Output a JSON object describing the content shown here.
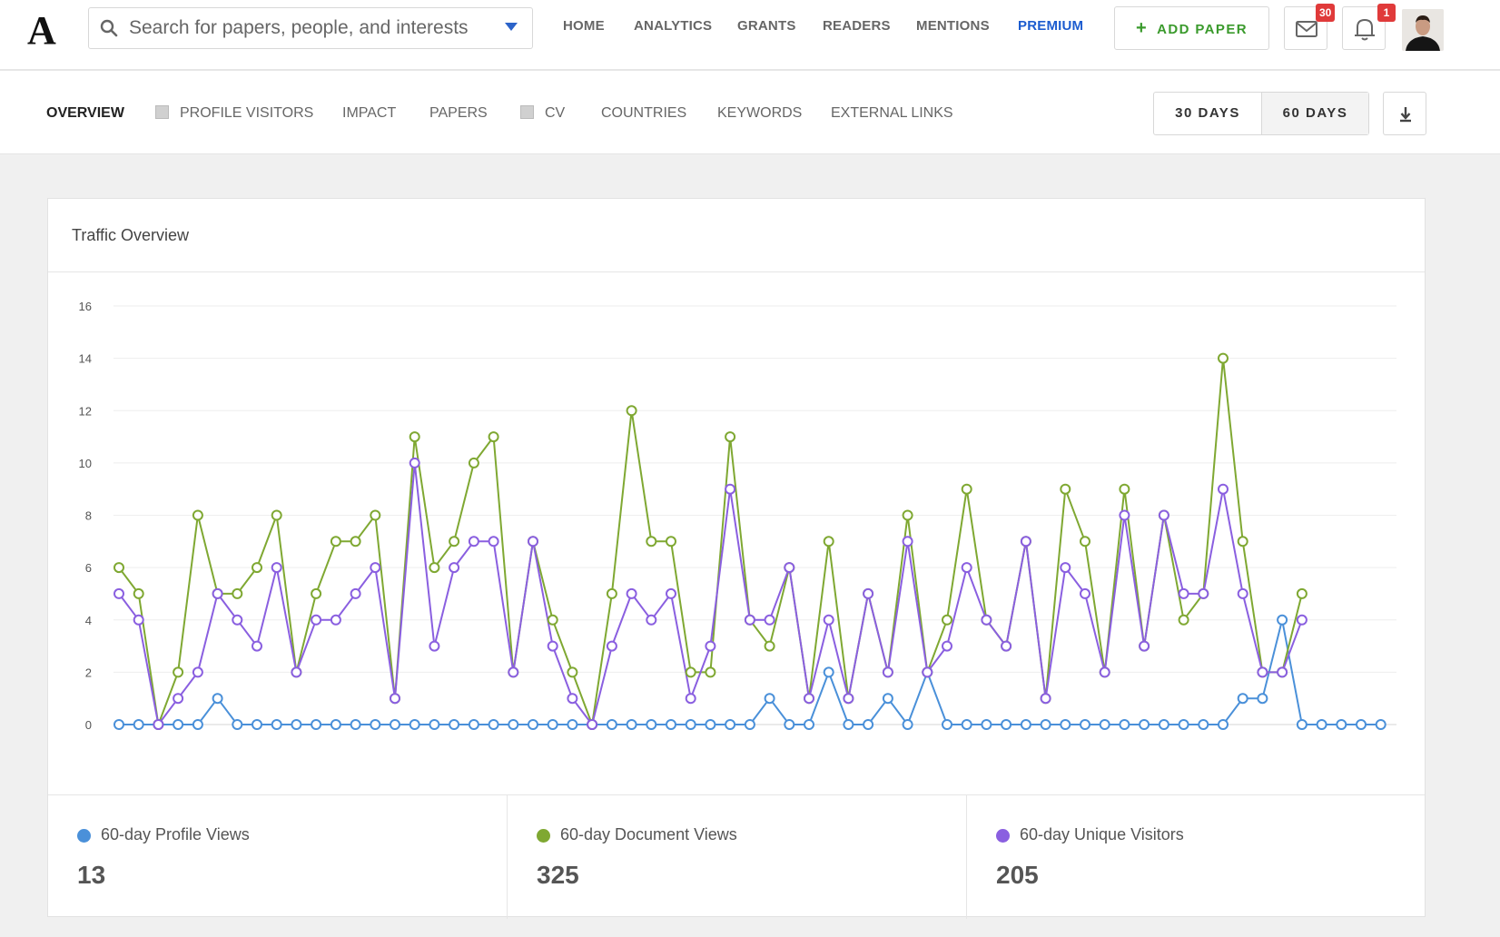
{
  "header": {
    "logo_text": "A",
    "search": {
      "placeholder": "Search for papers, people, and interests"
    },
    "nav": [
      {
        "label": "HOME"
      },
      {
        "label": "ANALYTICS"
      },
      {
        "label": "GRANTS"
      },
      {
        "label": "READERS"
      },
      {
        "label": "MENTIONS"
      },
      {
        "label": "PREMIUM"
      }
    ],
    "add_paper_label": "ADD PAPER",
    "messages_badge": "30",
    "notifications_badge": "1"
  },
  "subnav": {
    "tabs": [
      {
        "label": "OVERVIEW"
      },
      {
        "label": "PROFILE VISITORS"
      },
      {
        "label": "IMPACT"
      },
      {
        "label": "PAPERS"
      },
      {
        "label": "CV"
      },
      {
        "label": "COUNTRIES"
      },
      {
        "label": "KEYWORDS"
      },
      {
        "label": "EXTERNAL LINKS"
      }
    ],
    "range": {
      "option_30": "30 DAYS",
      "option_60": "60 DAYS",
      "selected": "60 DAYS"
    }
  },
  "card": {
    "title": "Traffic Overview"
  },
  "colors": {
    "profile": "#4a90d9",
    "document": "#7fa832",
    "visitors": "#8a5fe0",
    "accent": "#1c5ccf",
    "add": "#3a9a2c"
  },
  "chart_data": {
    "type": "line",
    "title": "Traffic Overview",
    "ylim": [
      0,
      16
    ],
    "yticks": [
      0,
      2,
      4,
      6,
      8,
      10,
      12,
      14,
      16
    ],
    "grid": true,
    "series": [
      {
        "name": "60-day Profile Views",
        "color": "#4a90d9",
        "values": [
          0,
          0,
          0,
          0,
          0,
          1,
          0,
          0,
          0,
          0,
          0,
          0,
          0,
          0,
          0,
          0,
          0,
          0,
          0,
          0,
          0,
          0,
          0,
          0,
          0,
          0,
          0,
          0,
          0,
          0,
          0,
          0,
          0,
          1,
          0,
          0,
          2,
          0,
          0,
          1,
          0,
          2,
          0,
          0,
          0,
          0,
          0,
          0,
          0,
          0,
          0,
          0,
          0,
          0,
          0,
          0,
          0,
          1,
          1,
          4,
          0,
          0,
          0,
          0,
          0
        ]
      },
      {
        "name": "60-day Document Views",
        "color": "#7fa832",
        "values": [
          6,
          5,
          0,
          2,
          8,
          5,
          5,
          6,
          8,
          2,
          5,
          7,
          7,
          8,
          1,
          11,
          6,
          7,
          10,
          11,
          2,
          7,
          4,
          2,
          0,
          5,
          12,
          7,
          7,
          2,
          2,
          11,
          4,
          3,
          6,
          1,
          7,
          1,
          5,
          2,
          8,
          2,
          4,
          9,
          4,
          3,
          7,
          1,
          9,
          7,
          2,
          9,
          3,
          8,
          4,
          5,
          14,
          7,
          2,
          2,
          5
        ]
      },
      {
        "name": "60-day Unique Visitors",
        "color": "#8a5fe0",
        "values": [
          5,
          4,
          0,
          1,
          2,
          5,
          4,
          3,
          6,
          2,
          4,
          4,
          5,
          6,
          1,
          10,
          3,
          6,
          7,
          7,
          2,
          7,
          3,
          1,
          0,
          3,
          5,
          4,
          5,
          1,
          3,
          9,
          4,
          4,
          6,
          1,
          4,
          1,
          5,
          2,
          7,
          2,
          3,
          6,
          4,
          3,
          7,
          1,
          6,
          5,
          2,
          8,
          3,
          8,
          5,
          5,
          9,
          5,
          2,
          2,
          4
        ]
      }
    ]
  },
  "stats": [
    {
      "label": "60-day Profile Views",
      "value": "13",
      "color": "#4a90d9"
    },
    {
      "label": "60-day Document Views",
      "value": "325",
      "color": "#7fa832"
    },
    {
      "label": "60-day Unique Visitors",
      "value": "205",
      "color": "#8a5fe0"
    }
  ]
}
